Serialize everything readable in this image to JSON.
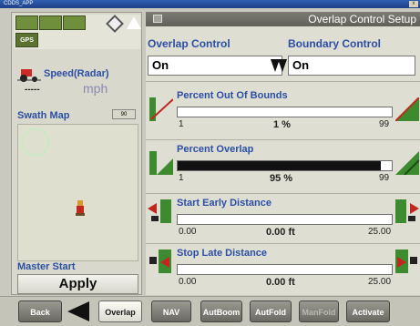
{
  "window": {
    "title": "CDDS_APP",
    "close_glyph": "x"
  },
  "left_panel": {
    "gps_label": "GPS",
    "speed_label": "Speed(Radar)",
    "speed_value": "-----",
    "speed_unit": "mph",
    "swath_map_label": "Swath Map",
    "swath_zoom": "90",
    "master_start_label": "Master Start",
    "apply_label": "Apply"
  },
  "right_panel": {
    "title": "Overlap Control Setup",
    "overlap_control_label": "Overlap Control",
    "overlap_control_value": "On",
    "boundary_control_label": "Boundary Control",
    "boundary_control_value": "On",
    "sections": [
      {
        "title": "Percent Out Of Bounds",
        "min": "1",
        "max": "99",
        "value": "1 %",
        "fraction": 0.0
      },
      {
        "title": "Percent Overlap",
        "min": "1",
        "max": "99",
        "value": "95 %",
        "fraction": 0.95
      },
      {
        "title": "Start Early Distance",
        "min": "0.00",
        "max": "25.00",
        "value": "0.00 ft",
        "fraction": 0.0
      },
      {
        "title": "Stop Late Distance",
        "min": "0.00",
        "max": "25.00",
        "value": "0.00 ft",
        "fraction": 0.0
      }
    ]
  },
  "bottom_bar": {
    "back": "Back",
    "overlap": "Overlap",
    "nav": "NAV",
    "autboom": "AutBoom",
    "autfold": "AutFold",
    "manfold": "ManFold",
    "activate": "Activate"
  },
  "colors": {
    "label_blue": "#2c4fa5",
    "bar_fill": "#111111",
    "green_icon": "#3e8a2e"
  }
}
